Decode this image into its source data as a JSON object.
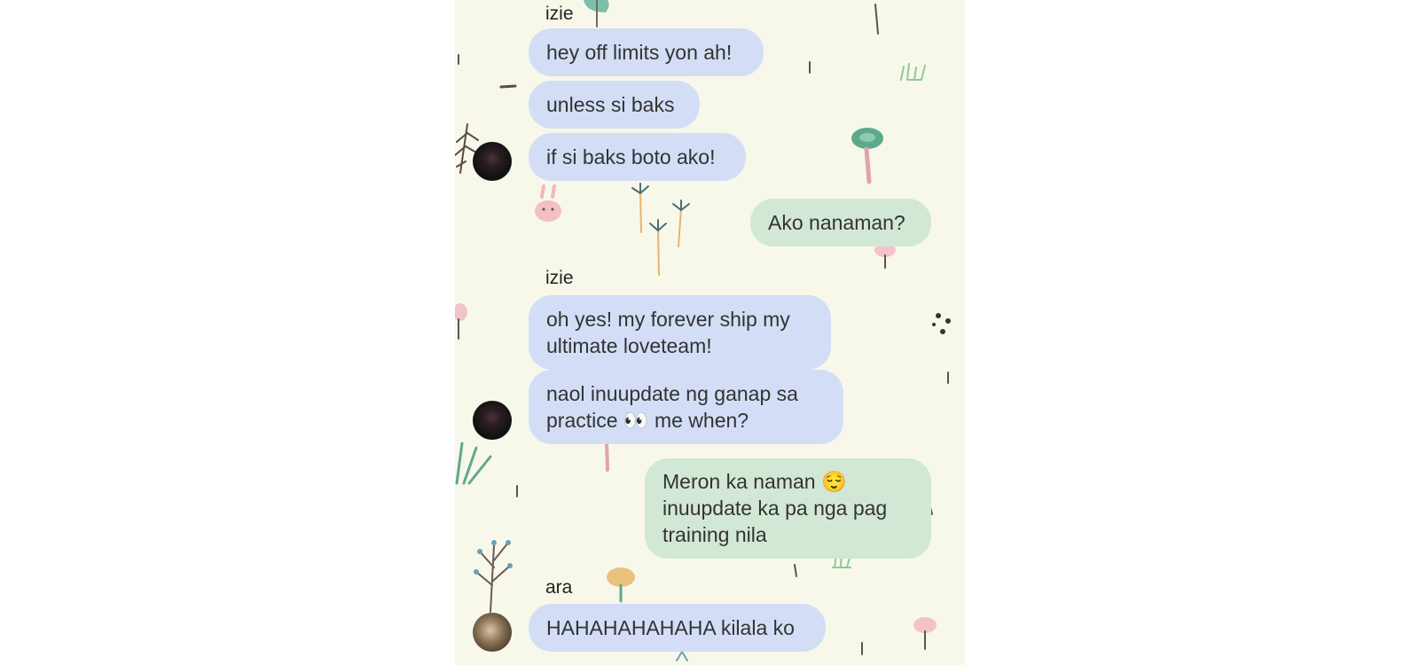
{
  "colors": {
    "background": "#f8f8ea",
    "incoming_bubble": "#d3def6",
    "outgoing_bubble": "#d3e8d4",
    "text": "#333333"
  },
  "messages": [
    {
      "sender": "izie",
      "avatar": "avatar-izie",
      "bubbles": [
        "hey off limits yon ah!",
        "unless si baks",
        "if si baks boto ako!"
      ]
    },
    {
      "sender": "me",
      "bubbles": [
        "Ako nanaman?"
      ]
    },
    {
      "sender": "izie",
      "avatar": "avatar-izie",
      "bubbles": [
        [
          "oh yes! my forever ship my",
          "ultimate loveteam!"
        ],
        [
          "naol inuupdate ng ganap sa",
          "practice 👀 me when?"
        ]
      ]
    },
    {
      "sender": "me",
      "bubbles": [
        [
          "Meron ka naman 😌",
          "inuupdate ka pa nga pag",
          "training nila"
        ]
      ]
    },
    {
      "sender": "ara",
      "avatar": "avatar-ara",
      "bubbles": [
        "HAHAHAHAHAHA kilala ko"
      ]
    }
  ]
}
